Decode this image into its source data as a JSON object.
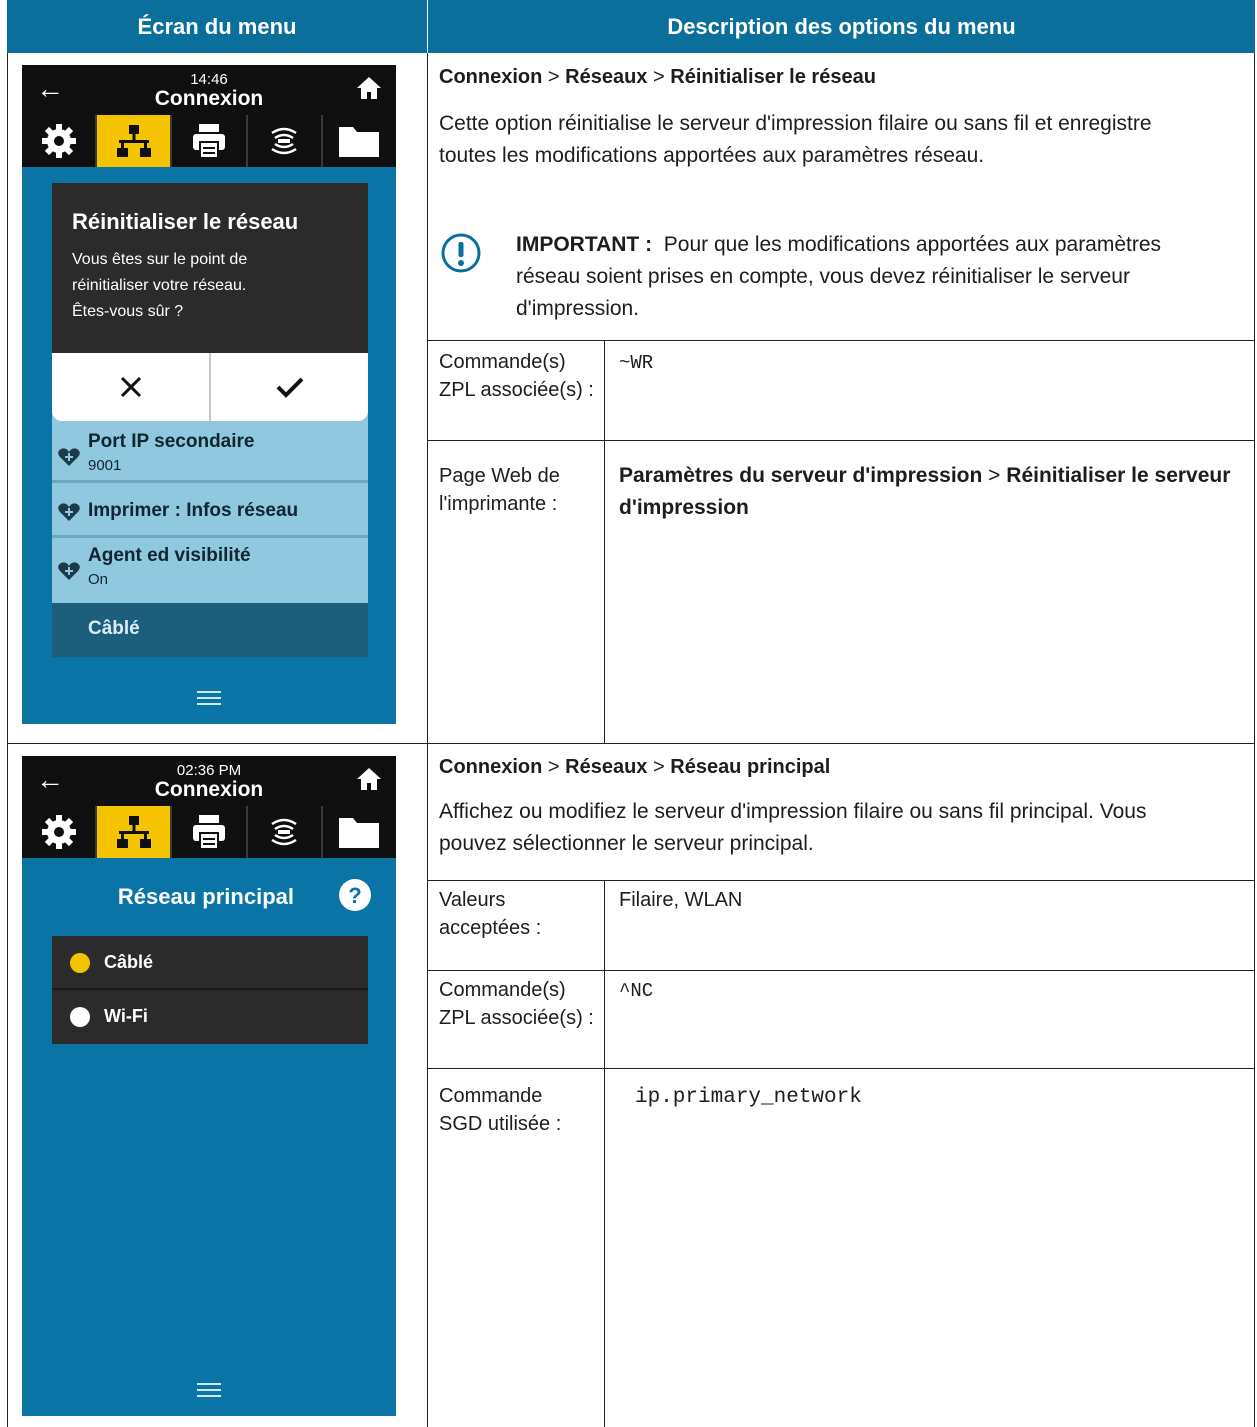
{
  "header": {
    "col_left": "Écran du menu",
    "col_right": "Description des options du menu"
  },
  "row1": {
    "screen": {
      "time": "14:46",
      "title": "Connexion",
      "dialog_title": "Réinitialiser le réseau",
      "dialog_text": [
        "Vous êtes sur le point de",
        "réinitialiser votre réseau.",
        "Êtes-vous sûr ?"
      ],
      "items": [
        {
          "label": "Port IP secondaire",
          "value": "9001"
        },
        {
          "label": "Imprimer : Infos réseau",
          "value": ""
        },
        {
          "label": "Agent ed visibilité",
          "value": "On"
        }
      ],
      "section": "Câblé"
    },
    "crumb": {
      "a": "Connexion",
      "sep1": ">",
      "b": "Réseaux",
      "sep2": ">",
      "c": "Réinitialiser le réseau"
    },
    "desc": "Cette option réinitialise le serveur d'impression filaire ou sans fil et enregistre toutes les modifications apportées aux paramètres réseau.",
    "important_label": "IMPORTANT :",
    "important_text": "Pour que les modifications apportées aux paramètres réseau soient prises en compte, vous devez réinitialiser le serveur d'impression.",
    "zpl_label": "Commande(s) ZPL associée(s) :",
    "zpl_value": "~WR",
    "web_label": "Page Web de l'imprimante :",
    "web_a": "Paramètres du serveur d'impression",
    "web_sep": ">",
    "web_b": "Réinitialiser le serveur d'impression"
  },
  "row2": {
    "screen": {
      "time": "02:36 PM",
      "title": "Connexion",
      "heading": "Réseau principal",
      "options": [
        {
          "label": "Câblé",
          "selected": true
        },
        {
          "label": "Wi-Fi",
          "selected": false
        }
      ]
    },
    "crumb": {
      "a": "Connexion",
      "sep1": ">",
      "b": "Réseaux",
      "sep2": ">",
      "c": "Réseau principal"
    },
    "desc": "Affichez ou modifiez le serveur d'impression filaire ou sans fil principal. Vous pouvez sélectionner le serveur principal.",
    "values_label": "Valeurs acceptées :",
    "values_value": "Filaire, WLAN",
    "zpl_label": "Commande(s) ZPL associée(s) :",
    "zpl_value": "^NC",
    "sgd_label": "Commande SGD utilisée :",
    "sgd_value": "ip.primary_network"
  },
  "colors": {
    "header_bg": "#0a6f9b",
    "screen_blue": "#0a74a6",
    "tab_active": "#f5c400",
    "list_blue": "#8fc8df"
  }
}
